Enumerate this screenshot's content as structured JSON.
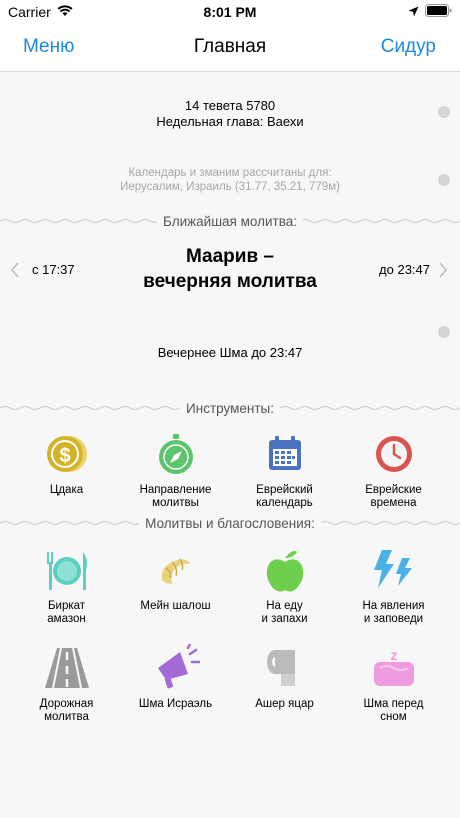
{
  "status": {
    "carrier": "Carrier",
    "time": "8:01 PM"
  },
  "nav": {
    "menu": "Меню",
    "title": "Главная",
    "siddur": "Сидур"
  },
  "date": {
    "hebrew": "14 тевета 5780",
    "parasha": "Недельная глава: Ваехи"
  },
  "location": {
    "line1": "Календарь и зманим рассчитаны для:",
    "line2": "Иерусалим, Израиль (31.77, 35.21, 779м)"
  },
  "prayer": {
    "section": "Ближайшая молитва:",
    "from": "с 17:37",
    "to": "до 23:47",
    "name_line1": "Маарив –",
    "name_line2": "вечерняя молитва",
    "shema": "Вечернее Шма до 23:47"
  },
  "tools": {
    "section": "Инструменты:",
    "items": [
      {
        "label": "Цдака",
        "icon": "coin-icon",
        "color": "#d4b426"
      },
      {
        "label": "Направление\nмолитвы",
        "icon": "compass-icon",
        "color": "#5cc46a"
      },
      {
        "label": "Еврейский\nкалендарь",
        "icon": "calendar-icon",
        "color": "#4a74c2"
      },
      {
        "label": "Еврейские\nвремена",
        "icon": "clock-icon",
        "color": "#d9534f"
      }
    ]
  },
  "blessings": {
    "section": "Молитвы и благословения:",
    "row1": [
      {
        "label": "Биркат\nамазон",
        "icon": "plate-icon",
        "color": "#5cd0c0"
      },
      {
        "label": "Мейн шалош",
        "icon": "croissant-icon",
        "color": "#e8d27a"
      },
      {
        "label": "На еду\nи запахи",
        "icon": "apple-icon",
        "color": "#6dcf4c"
      },
      {
        "label": "На явления\nи заповеди",
        "icon": "lightning-icon",
        "color": "#4ab0e6"
      }
    ],
    "row2": [
      {
        "label": "Дорожная\nмолитва",
        "icon": "road-icon",
        "color": "#9a9a9a"
      },
      {
        "label": "Шма Исраэль",
        "icon": "megaphone-icon",
        "color": "#a36ad6"
      },
      {
        "label": "Ашер яцар",
        "icon": "toilet-paper-icon",
        "color": "#bbbbbb"
      },
      {
        "label": "Шма перед\nсном",
        "icon": "sleep-icon",
        "color": "#ee9be0"
      }
    ]
  }
}
